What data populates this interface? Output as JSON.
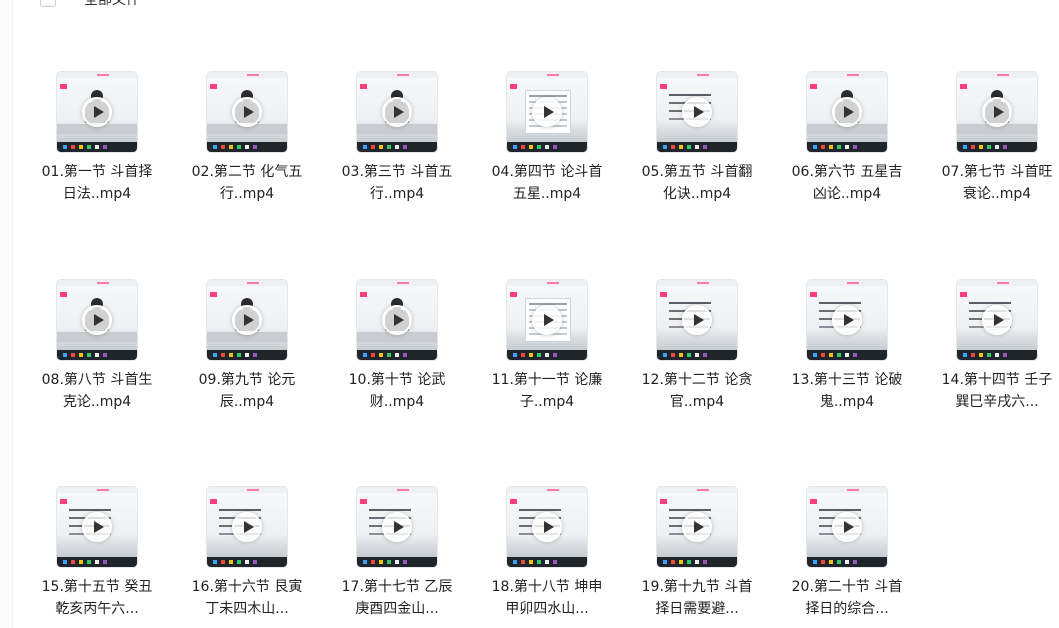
{
  "header": {
    "select_all_label": "全部文件"
  },
  "files": [
    {
      "name": "01.第一节 斗首择日法..mp4",
      "thumb": "lecture"
    },
    {
      "name": "02.第二节 化气五行..mp4",
      "thumb": "lecture"
    },
    {
      "name": "03.第三节 斗首五行..mp4",
      "thumb": "lecture"
    },
    {
      "name": "04.第四节 论斗首五星..mp4",
      "thumb": "table"
    },
    {
      "name": "05.第五节 斗首翻化诀..mp4",
      "thumb": "slide"
    },
    {
      "name": "06.第六节 五星吉凶论..mp4",
      "thumb": "lecture"
    },
    {
      "name": "07.第七节 斗首旺衰论..mp4",
      "thumb": "lecture"
    },
    {
      "name": "08.第八节 斗首生克论..mp4",
      "thumb": "lecture"
    },
    {
      "name": "09.第九节 论元辰..mp4",
      "thumb": "lecture"
    },
    {
      "name": "10.第十节 论武财..mp4",
      "thumb": "lecture"
    },
    {
      "name": "11.第十一节 论廉子..mp4",
      "thumb": "table"
    },
    {
      "name": "12.第十二节 论贪官..mp4",
      "thumb": "slide"
    },
    {
      "name": "13.第十三节 论破鬼..mp4",
      "thumb": "slide"
    },
    {
      "name": "14.第十四节 壬子巽巳辛戌六...",
      "thumb": "slide"
    },
    {
      "name": "15.第十五节 癸丑乾亥丙午六...",
      "thumb": "slide"
    },
    {
      "name": "16.第十六节 艮寅丁未四木山...",
      "thumb": "slide"
    },
    {
      "name": "17.第十七节 乙辰庚酉四金山...",
      "thumb": "slide"
    },
    {
      "name": "18.第十八节 坤申甲卯四水山...",
      "thumb": "slide"
    },
    {
      "name": "19.第十九节 斗首择日需要避...",
      "thumb": "slide"
    },
    {
      "name": "20.第二十节 斗首择日的综合...",
      "thumb": "slide"
    }
  ]
}
